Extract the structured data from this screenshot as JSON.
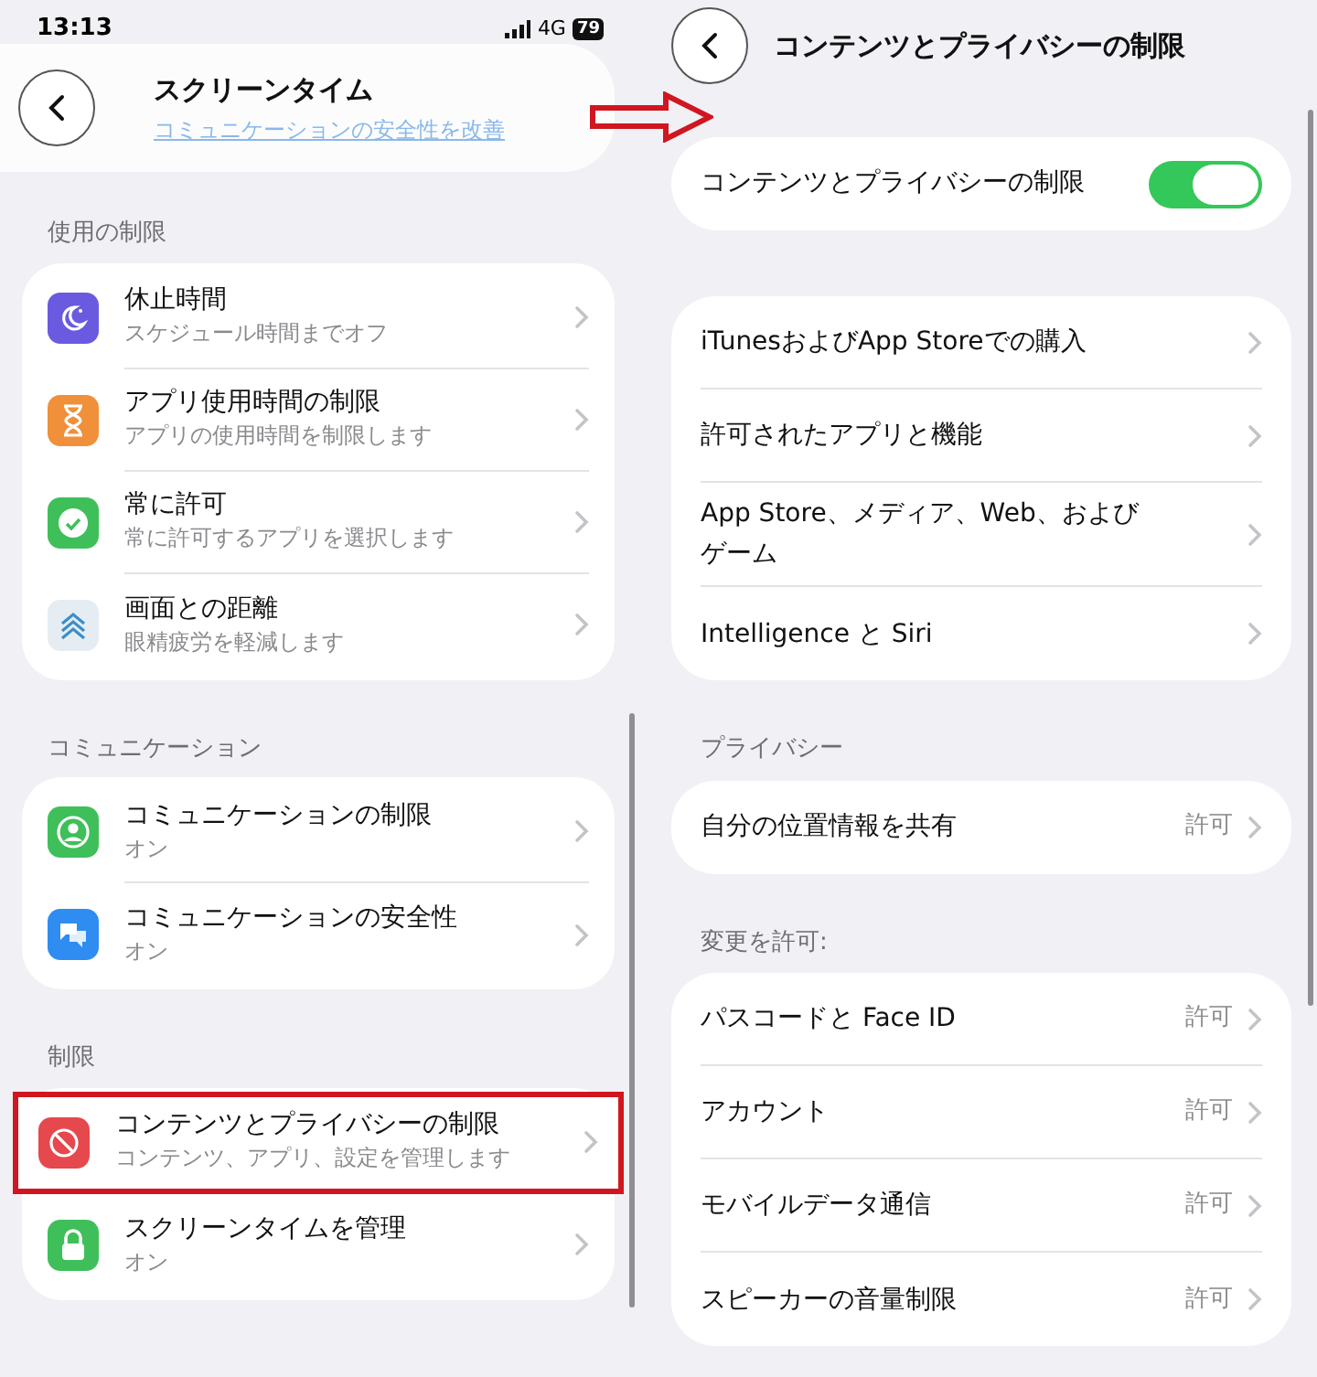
{
  "left": {
    "status_bar": {
      "time": "13:13",
      "network": "4G",
      "battery": "79"
    },
    "title": "スクリーンタイム",
    "blurred_link": "コミュニケーションの安全性を改善",
    "sections": [
      {
        "header": "使用の制限",
        "items": [
          {
            "title": "休止時間",
            "subtitle": "スケジュール時間までオフ",
            "kind": "moon",
            "color": "#6a5ae0",
            "highlighted": false
          },
          {
            "title": "アプリ使用時間の制限",
            "subtitle": "アプリの使用時間を制限します",
            "kind": "hourglass",
            "color": "#f0903a",
            "highlighted": false
          },
          {
            "title": "常に許可",
            "subtitle": "常に許可するアプリを選択します",
            "kind": "check",
            "color": "#3fbf5a",
            "highlighted": false
          },
          {
            "title": "画面との距離",
            "subtitle": "眼精疲労を軽減します",
            "kind": "chevrons",
            "color": "#e6edf2",
            "highlighted": false
          }
        ]
      },
      {
        "header": "コミュニケーション",
        "items": [
          {
            "title": "コミュニケーションの制限",
            "subtitle": "オン",
            "kind": "person",
            "color": "#3fbf5a",
            "highlighted": false
          },
          {
            "title": "コミュニケーションの安全性",
            "subtitle": "オン",
            "kind": "chat",
            "color": "#2f8cf0",
            "highlighted": false
          }
        ]
      },
      {
        "header": "制限",
        "items": [
          {
            "title": "コンテンツとプライバシーの制限",
            "subtitle": "コンテンツ、アプリ、設定を管理します",
            "kind": "block",
            "color": "#e5484d",
            "highlighted": true
          },
          {
            "title": "スクリーンタイムを管理",
            "subtitle": "オン",
            "kind": "lock",
            "color": "#3fbf5a",
            "highlighted": false
          }
        ]
      }
    ]
  },
  "right": {
    "title": "コンテンツとプライバシーの制限",
    "toggle": {
      "label": "コンテンツとプライバシーの制限",
      "on": true
    },
    "groups": [
      {
        "items": [
          {
            "label": "iTunesおよびApp Storeでの購入"
          },
          {
            "label": "許可されたアプリと機能"
          },
          {
            "label": "App Store、メディア、Web、およびゲーム"
          },
          {
            "label": "Intelligence と Siri"
          }
        ]
      },
      {
        "header": "プライバシー",
        "items": [
          {
            "label": "自分の位置情報を共有",
            "value": "許可"
          }
        ]
      },
      {
        "header": "変更を許可:",
        "items": [
          {
            "label": "パスコードと Face ID",
            "value": "許可"
          },
          {
            "label": "アカウント",
            "value": "許可"
          },
          {
            "label": "モバイルデータ通信",
            "value": "許可"
          },
          {
            "label": "スピーカーの音量制限",
            "value": "許可"
          }
        ]
      }
    ]
  }
}
